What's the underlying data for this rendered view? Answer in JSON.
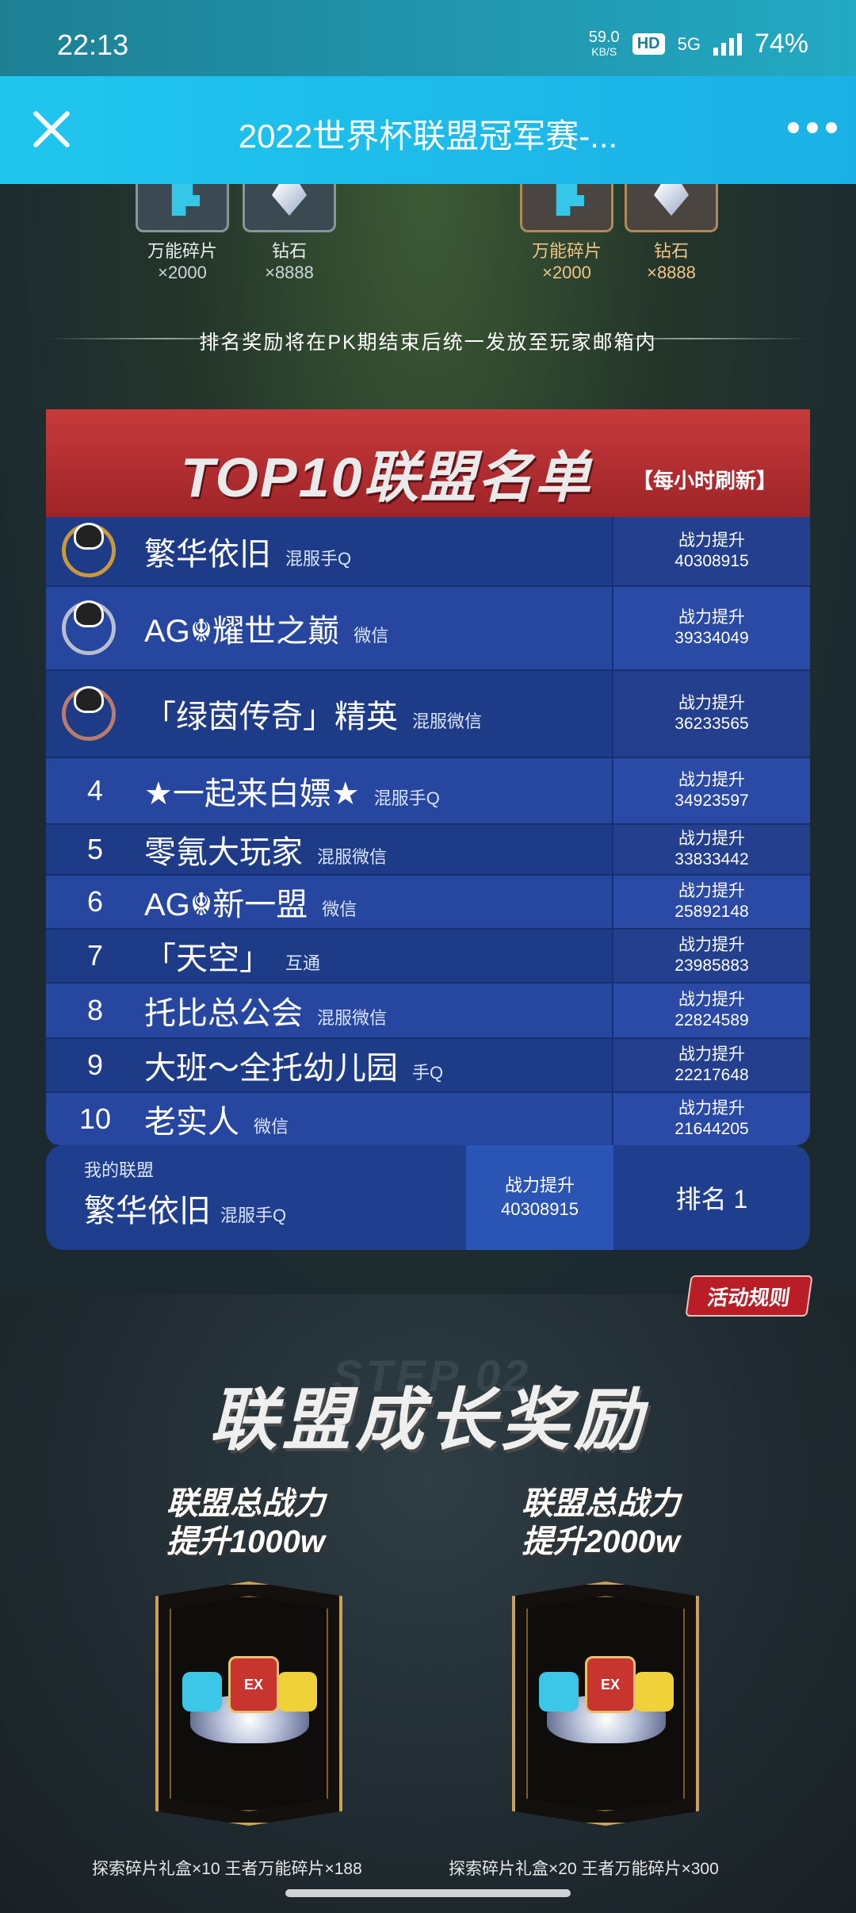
{
  "status_bar": {
    "time": "22:13",
    "net_speed": "59.0",
    "net_unit": "KB/S",
    "hd": "HD",
    "network": "5G",
    "battery": "74%"
  },
  "title_bar": {
    "title": "2022世界杯联盟冠军赛-..."
  },
  "top_rewards": [
    {
      "name": "万能碎片",
      "qty": "×2000",
      "icon": "puzzle-piece-icon",
      "style": "silver"
    },
    {
      "name": "钻石",
      "qty": "×8888",
      "icon": "diamond-icon",
      "style": "silver"
    },
    {
      "name": "万能碎片",
      "qty": "×2000",
      "icon": "puzzle-piece-icon",
      "style": "gold"
    },
    {
      "name": "钻石",
      "qty": "×8888",
      "icon": "diamond-icon",
      "style": "gold"
    }
  ],
  "rank_notice": "排名奖励将在PK期结束后统一发放至玩家邮箱内",
  "top10": {
    "title": "TOP10联盟名单",
    "subtitle": "【每小时刷新】",
    "power_label": "战力提升",
    "rows": [
      {
        "rank": "1",
        "name": "繁华依旧",
        "server": "混服手Q",
        "power": "40308915"
      },
      {
        "rank": "2",
        "name": "AG☬耀世之巅",
        "server": "微信",
        "power": "39334049"
      },
      {
        "rank": "3",
        "name": "「绿茵传奇」精英",
        "server": "混服微信",
        "power": "36233565"
      },
      {
        "rank": "4",
        "name": "★一起来白嫖★",
        "server": "混服手Q",
        "power": "34923597"
      },
      {
        "rank": "5",
        "name": "零氪大玩家",
        "server": "混服微信",
        "power": "33833442"
      },
      {
        "rank": "6",
        "name": "AG☬新一盟",
        "server": "微信",
        "power": "25892148"
      },
      {
        "rank": "7",
        "name": "「天空」",
        "server": "互通",
        "power": "23985883"
      },
      {
        "rank": "8",
        "name": "托比总公会",
        "server": "混服微信",
        "power": "22824589"
      },
      {
        "rank": "9",
        "name": "大班～全托幼儿园",
        "server": "手Q",
        "power": "22217648"
      },
      {
        "rank": "10",
        "name": "老实人",
        "server": "微信",
        "power": "21644205"
      }
    ]
  },
  "my_alliance": {
    "label": "我的联盟",
    "name": "繁华依旧",
    "server": "混服手Q",
    "power_label": "战力提升",
    "power": "40308915",
    "rank": "排名 1"
  },
  "rules_button": "活动规则",
  "growth": {
    "bg_text": "STEP 02",
    "title": "联盟成长奖励",
    "tiers": [
      {
        "line1": "联盟总战力",
        "line2": "提升1000w",
        "caption": "探索碎片礼盒×10 王者万能碎片×188",
        "badge": "EX"
      },
      {
        "line1": "联盟总战力",
        "line2": "提升2000w",
        "caption": "探索碎片礼盒×20 王者万能碎片×300",
        "badge": "EX"
      }
    ]
  }
}
